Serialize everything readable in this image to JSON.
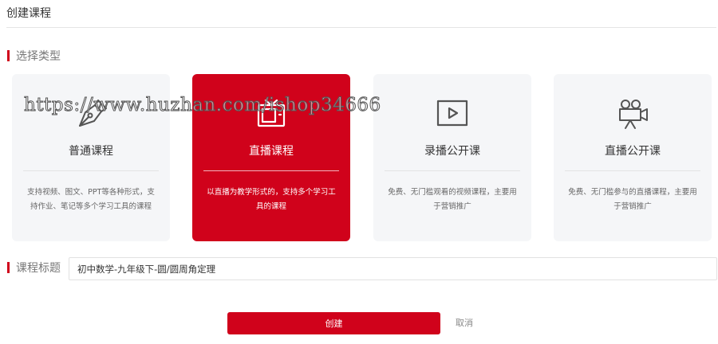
{
  "page": {
    "title": "创建课程"
  },
  "type_section": {
    "label": "选择类型"
  },
  "course_types": [
    {
      "name": "普通课程",
      "description": "支持视频、图文、PPT等各种形式，支持作业、笔记等多个学习工具的课程",
      "icon": "pen-nib-icon",
      "selected": false
    },
    {
      "name": "直播课程",
      "description": "以直播为教学形式的，支持多个学习工具的课程",
      "icon": "tv-icon",
      "selected": true
    },
    {
      "name": "录播公开课",
      "description": "免费、无门槛观看的视频课程，主要用于营销推广",
      "icon": "play-video-icon",
      "selected": false
    },
    {
      "name": "直播公开课",
      "description": "免费、无门槛参与的直播课程，主要用于营销推广",
      "icon": "movie-camera-icon",
      "selected": false
    }
  ],
  "title_section": {
    "label": "课程标题",
    "value": "初中数学-九年级下-圆/圆周角定理"
  },
  "actions": {
    "create_label": "创建",
    "cancel_label": "取消"
  },
  "watermark": {
    "text": "https://www.huzhan.com/ishop34666"
  },
  "colors": {
    "accent": "#d0021b",
    "card_bg": "#f5f6f8",
    "divider": "#e5e5e5"
  }
}
